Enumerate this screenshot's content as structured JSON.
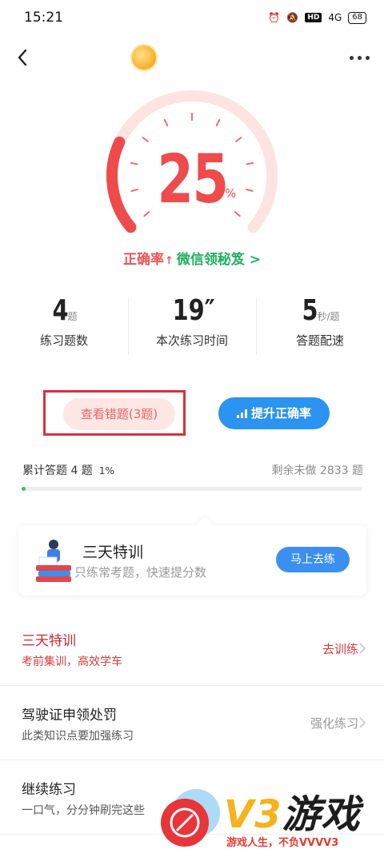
{
  "status_bar": {
    "time": "15:21",
    "hd": "HD",
    "signal": "4G",
    "battery": "68"
  },
  "nav": {
    "back_icon": "back-arrow-icon",
    "coin_icon": "coin-icon",
    "more_icon": "more-icon"
  },
  "gauge": {
    "value": "25",
    "unit": "%",
    "progress": 0.25,
    "accent_color": "#ee4b4b"
  },
  "accuracy": {
    "label": "正确率",
    "arrow": "↑",
    "link": "微信领秘笈 >"
  },
  "stats": [
    {
      "value": "4",
      "unit": "题",
      "label": "练习题数"
    },
    {
      "value": "19″",
      "unit": "",
      "label": "本次练习时间"
    },
    {
      "value": "5",
      "unit": "秒/题",
      "label": "答题配速"
    }
  ],
  "actions": {
    "wrong_button": "查看错题(3题)",
    "improve_button": "提升正确率"
  },
  "progress": {
    "done_label": "累计答题 4 题",
    "percent": "1%",
    "remaining": "剩余未做 2833 题",
    "fraction": 0.01,
    "fill_color": "#3ac069"
  },
  "promo": {
    "title": "三天特训",
    "subtitle": "只练常考题，快速提分数",
    "button": "马上去练"
  },
  "list": [
    {
      "title": "三天特训",
      "sub": "考前集训，高效学车",
      "action": "去训练"
    },
    {
      "title": "驾驶证申领处罚",
      "sub": "此类知识点要加强练习",
      "action": "强化练习"
    },
    {
      "title": "继续练习",
      "sub": "一口气，分分钟刷完这些",
      "action": ""
    }
  ],
  "watermark": {
    "brand_v3": "V3",
    "brand_name": "游戏",
    "slogan": "游戏人生，不负VVVV3"
  }
}
